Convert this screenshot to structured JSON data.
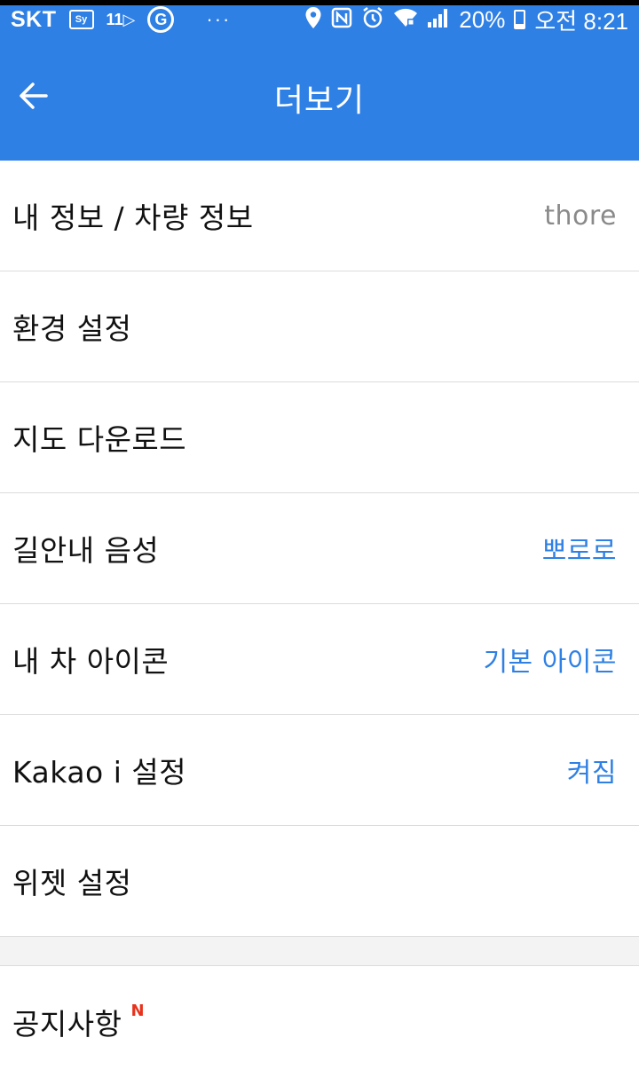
{
  "status_bar": {
    "carrier": "SKT",
    "sy_label": "Sy",
    "eleven_label": "11",
    "g_label": "G",
    "dots": "···",
    "battery_percent": "20%",
    "battery_level": 0.2,
    "time": "오전 8:21"
  },
  "app_bar": {
    "title": "더보기"
  },
  "menu": {
    "items": [
      {
        "label": "내 정보 / 차량 정보",
        "value": "thore"
      },
      {
        "label": "환경 설정",
        "value": ""
      },
      {
        "label": "지도 다운로드",
        "value": ""
      },
      {
        "label": "길안내 음성",
        "value": "뽀로로"
      },
      {
        "label": "내 차 아이콘",
        "value": "기본 아이콘"
      },
      {
        "label": "Kakao i 설정",
        "value": "켜짐"
      },
      {
        "label": "위젯 설정",
        "value": ""
      }
    ]
  },
  "notice": {
    "label": "공지사항",
    "badge": "N"
  },
  "colors": {
    "primary": "#2f80e4",
    "value_gray": "#8a8a8a",
    "badge_red": "#e8321c"
  }
}
